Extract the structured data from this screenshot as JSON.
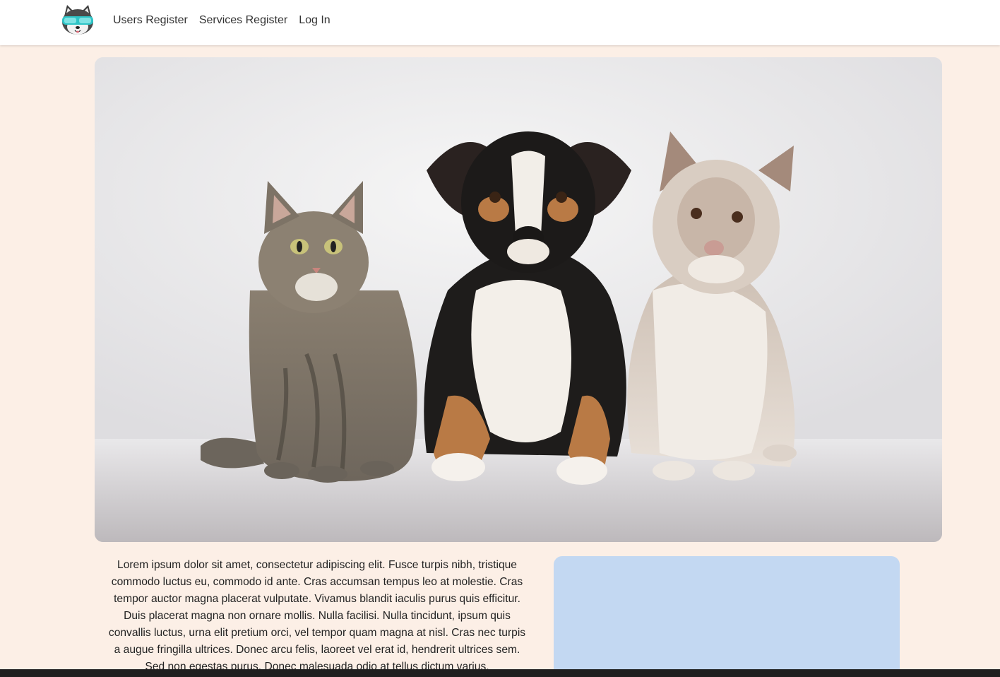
{
  "navbar": {
    "logo_icon": "husky-with-goggles-logo",
    "links": [
      {
        "label": "Users Register"
      },
      {
        "label": "Services Register"
      },
      {
        "label": "Log In"
      }
    ]
  },
  "hero": {
    "image_subject": "cat-and-two-dogs-photo"
  },
  "intro": {
    "text": "Lorem ipsum dolor sit amet, consectetur adipiscing elit. Fusce turpis nibh, tristique commodo luctus eu, commodo id ante. Cras accumsan tempus leo at molestie. Cras tempor auctor magna placerat vulputate. Vivamus blandit iaculis purus quis efficitur. Duis placerat magna non ornare mollis. Nulla facilisi. Nulla tincidunt, ipsum quis convallis luctus, urna elit pretium orci, vel tempor quam magna at nisl. Cras nec turpis a augue fringilla ultrices. Donec arcu felis, laoreet vel erat id, hendrerit ultrices sem. Sed non egestas purus. Donec malesuada odio at tellus dictum varius."
  },
  "colors": {
    "page_background": "#fcefe6",
    "navbar_background": "#ffffff",
    "side_card": "#c3d8f2"
  }
}
